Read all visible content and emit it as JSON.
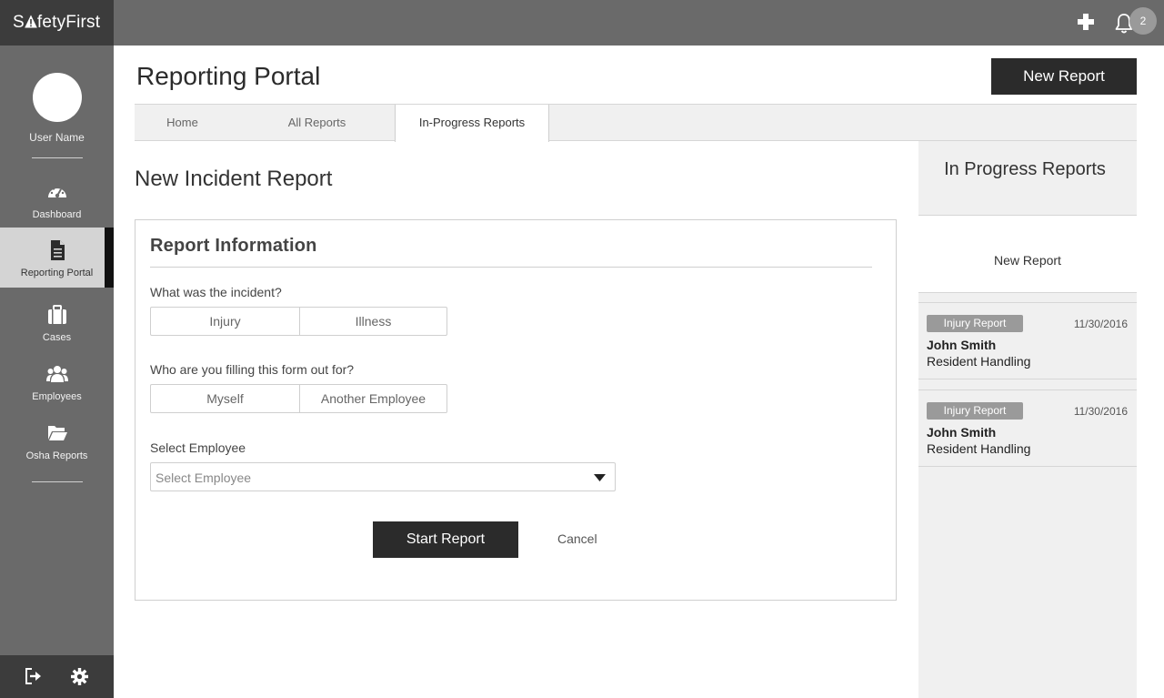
{
  "app": {
    "brand_prefix": "S",
    "brand_suffix": "fetyFirst",
    "notification_count": "2"
  },
  "sidebar": {
    "user_name": "User Name",
    "items": [
      {
        "label": "Dashboard",
        "icon": "dashboard-gauge-icon"
      },
      {
        "label": "Reporting Portal",
        "icon": "document-icon",
        "active": true
      },
      {
        "label": "Cases",
        "icon": "briefcase-icon"
      },
      {
        "label": "Employees",
        "icon": "users-icon"
      },
      {
        "label": "Osha Reports",
        "icon": "folder-open-icon"
      }
    ]
  },
  "header": {
    "title": "Reporting Portal",
    "new_report_label": "New Report"
  },
  "tabs": [
    {
      "label": "Home"
    },
    {
      "label": "All Reports"
    },
    {
      "label": "In-Progress Reports",
      "active": true
    }
  ],
  "form": {
    "section_title": "New Incident Report",
    "card_title": "Report Information",
    "q1_label": "What was the incident?",
    "q1_options": [
      "Injury",
      "Illness"
    ],
    "q2_label": "Who are you filling this form out for?",
    "q2_options": [
      "Myself",
      "Another Employee"
    ],
    "employee_label": "Select Employee",
    "employee_value": "Select Employee",
    "start_label": "Start Report",
    "cancel_label": "Cancel"
  },
  "right_panel": {
    "title": "In Progress Reports",
    "new_report_label": "New Report",
    "reports": [
      {
        "type": "Injury Report",
        "date": "11/30/2016",
        "name": "John Smith",
        "department": "Resident Handling"
      },
      {
        "type": "Injury Report",
        "date": "11/30/2016",
        "name": "John Smith",
        "department": "Resident Handling"
      }
    ]
  },
  "colors": {
    "sidebar": "#6a6a6a",
    "brand_bg": "#3c3c3c",
    "primary_button": "#2b2b2b",
    "badge": "#9a9a9a",
    "panel_bg": "#f0f0f0"
  }
}
